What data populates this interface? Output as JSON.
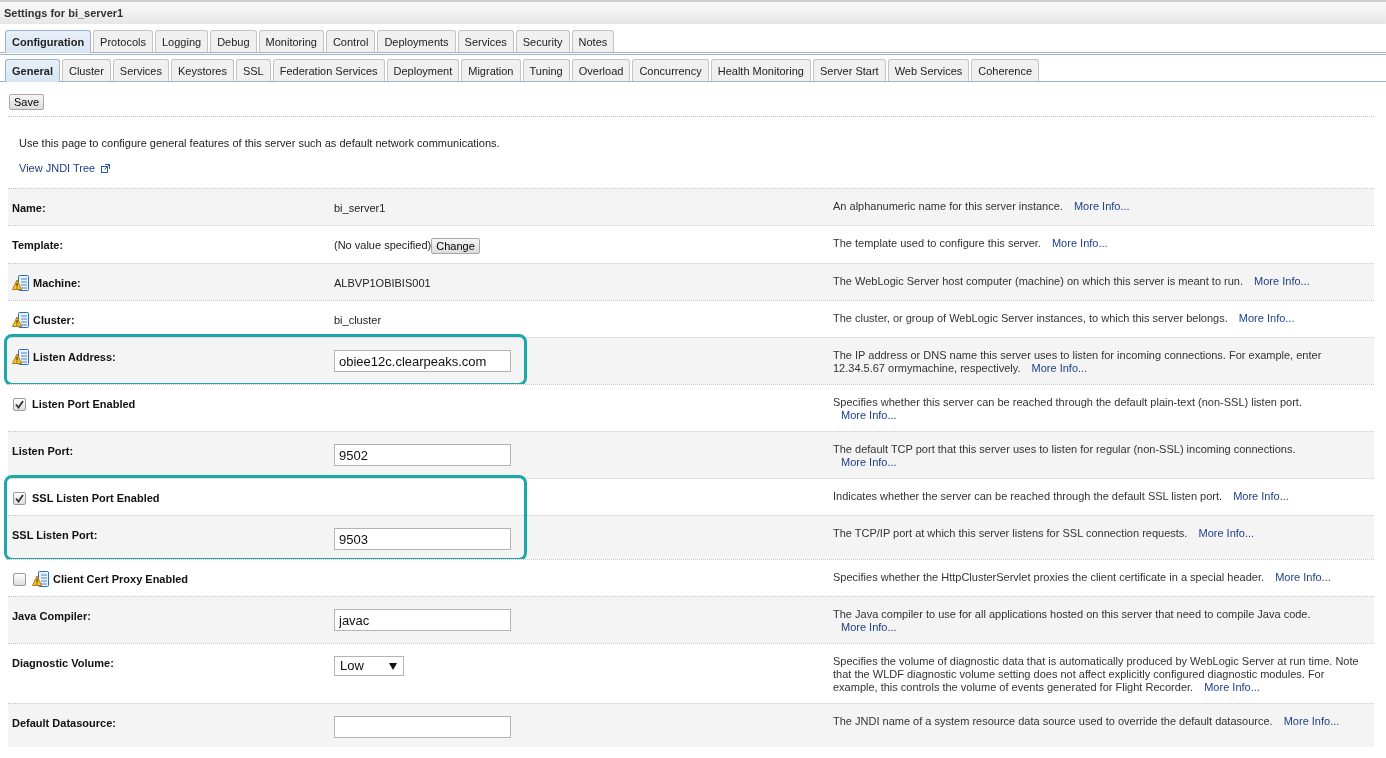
{
  "title": "Settings for bi_server1",
  "tabs": [
    {
      "label": "Configuration",
      "selected": true
    },
    {
      "label": "Protocols",
      "selected": false
    },
    {
      "label": "Logging",
      "selected": false
    },
    {
      "label": "Debug",
      "selected": false
    },
    {
      "label": "Monitoring",
      "selected": false
    },
    {
      "label": "Control",
      "selected": false
    },
    {
      "label": "Deployments",
      "selected": false
    },
    {
      "label": "Services",
      "selected": false
    },
    {
      "label": "Security",
      "selected": false
    },
    {
      "label": "Notes",
      "selected": false
    }
  ],
  "subtabs": [
    {
      "label": "General",
      "selected": true
    },
    {
      "label": "Cluster",
      "selected": false
    },
    {
      "label": "Services",
      "selected": false
    },
    {
      "label": "Keystores",
      "selected": false
    },
    {
      "label": "SSL",
      "selected": false
    },
    {
      "label": "Federation Services",
      "selected": false
    },
    {
      "label": "Deployment",
      "selected": false
    },
    {
      "label": "Migration",
      "selected": false
    },
    {
      "label": "Tuning",
      "selected": false
    },
    {
      "label": "Overload",
      "selected": false
    },
    {
      "label": "Concurrency",
      "selected": false
    },
    {
      "label": "Health Monitoring",
      "selected": false
    },
    {
      "label": "Server Start",
      "selected": false
    },
    {
      "label": "Web Services",
      "selected": false
    },
    {
      "label": "Coherence",
      "selected": false
    }
  ],
  "save_button": "Save",
  "intro": "Use this page to configure general features of this server such as default network communications.",
  "jndi_link": "View JNDI Tree",
  "sections": [
    {
      "highlighted": false,
      "rows": [
        {
          "kind": "text",
          "label": "Name:",
          "flagged": false,
          "value": "bi_server1",
          "description": "An alphanumeric name for this server instance.",
          "more_info": "More Info..."
        },
        {
          "kind": "template",
          "label": "Template:",
          "flagged": false,
          "value": "(No value specified)",
          "button": "Change",
          "description": "The template used to configure this server.",
          "more_info": "More Info..."
        },
        {
          "kind": "text",
          "label": "Machine:",
          "flagged": true,
          "value": "ALBVP1OBIBIS001",
          "description": "The WebLogic Server host computer (machine) on which this server is meant to run.",
          "more_info": "More Info..."
        },
        {
          "kind": "text",
          "label": "Cluster:",
          "flagged": true,
          "value": "bi_cluster",
          "description": "The cluster, or group of WebLogic Server instances, to which this server belongs.",
          "more_info": "More Info..."
        }
      ]
    },
    {
      "highlighted": true,
      "rows": [
        {
          "kind": "field",
          "label": "Listen Address:",
          "flagged": true,
          "value": "obiee12c.clearpeaks.com",
          "description": "The IP address or DNS name this server uses to listen for incoming connections. For example, enter 12.34.5.67 ormymachine, respectively.",
          "more_info": "More Info..."
        }
      ]
    },
    {
      "highlighted": false,
      "rows": [
        {
          "kind": "checkbox",
          "label": "Listen Port Enabled",
          "flagged": false,
          "checked": true,
          "description": "Specifies whether this server can be reached through the default plain-text (non-SSL) listen port.",
          "more_info": "More Info..."
        },
        {
          "kind": "field",
          "label": "Listen Port:",
          "flagged": false,
          "value": "9502",
          "description": "The default TCP port that this server uses to listen for regular (non-SSL) incoming connections.",
          "more_info": "More Info..."
        }
      ]
    },
    {
      "highlighted": true,
      "rows": [
        {
          "kind": "checkbox",
          "label": "SSL Listen Port Enabled",
          "flagged": false,
          "checked": true,
          "description": "Indicates whether the server can be reached through the default SSL listen port.",
          "more_info": "More Info..."
        },
        {
          "kind": "field",
          "label": "SSL Listen Port:",
          "flagged": false,
          "value": "9503",
          "description": "The TCP/IP port at which this server listens for SSL connection requests.",
          "more_info": "More Info..."
        }
      ]
    },
    {
      "highlighted": false,
      "rows": [
        {
          "kind": "checkbox",
          "label": "Client Cert Proxy Enabled",
          "flagged": true,
          "checked": false,
          "description": "Specifies whether the HttpClusterServlet proxies the client certificate in a special header.",
          "more_info": "More Info..."
        },
        {
          "kind": "field",
          "label": "Java Compiler:",
          "flagged": false,
          "value": "javac",
          "description": "The Java compiler to use for all applications hosted on this server that need to compile Java code.",
          "more_info": "More Info..."
        },
        {
          "kind": "select",
          "label": "Diagnostic Volume:",
          "flagged": false,
          "value": "Low",
          "description": "Specifies the volume of diagnostic data that is automatically produced by WebLogic Server at run time. Note that the WLDF diagnostic volume setting does not affect explicitly configured diagnostic modules. For example, this controls the volume of events generated for Flight Recorder.",
          "more_info": "More Info..."
        },
        {
          "kind": "field",
          "label": "Default Datasource:",
          "flagged": false,
          "description": "The JNDI name of a system resource data source used to override the default datasource.",
          "more_info": "More Info..."
        }
      ]
    }
  ]
}
